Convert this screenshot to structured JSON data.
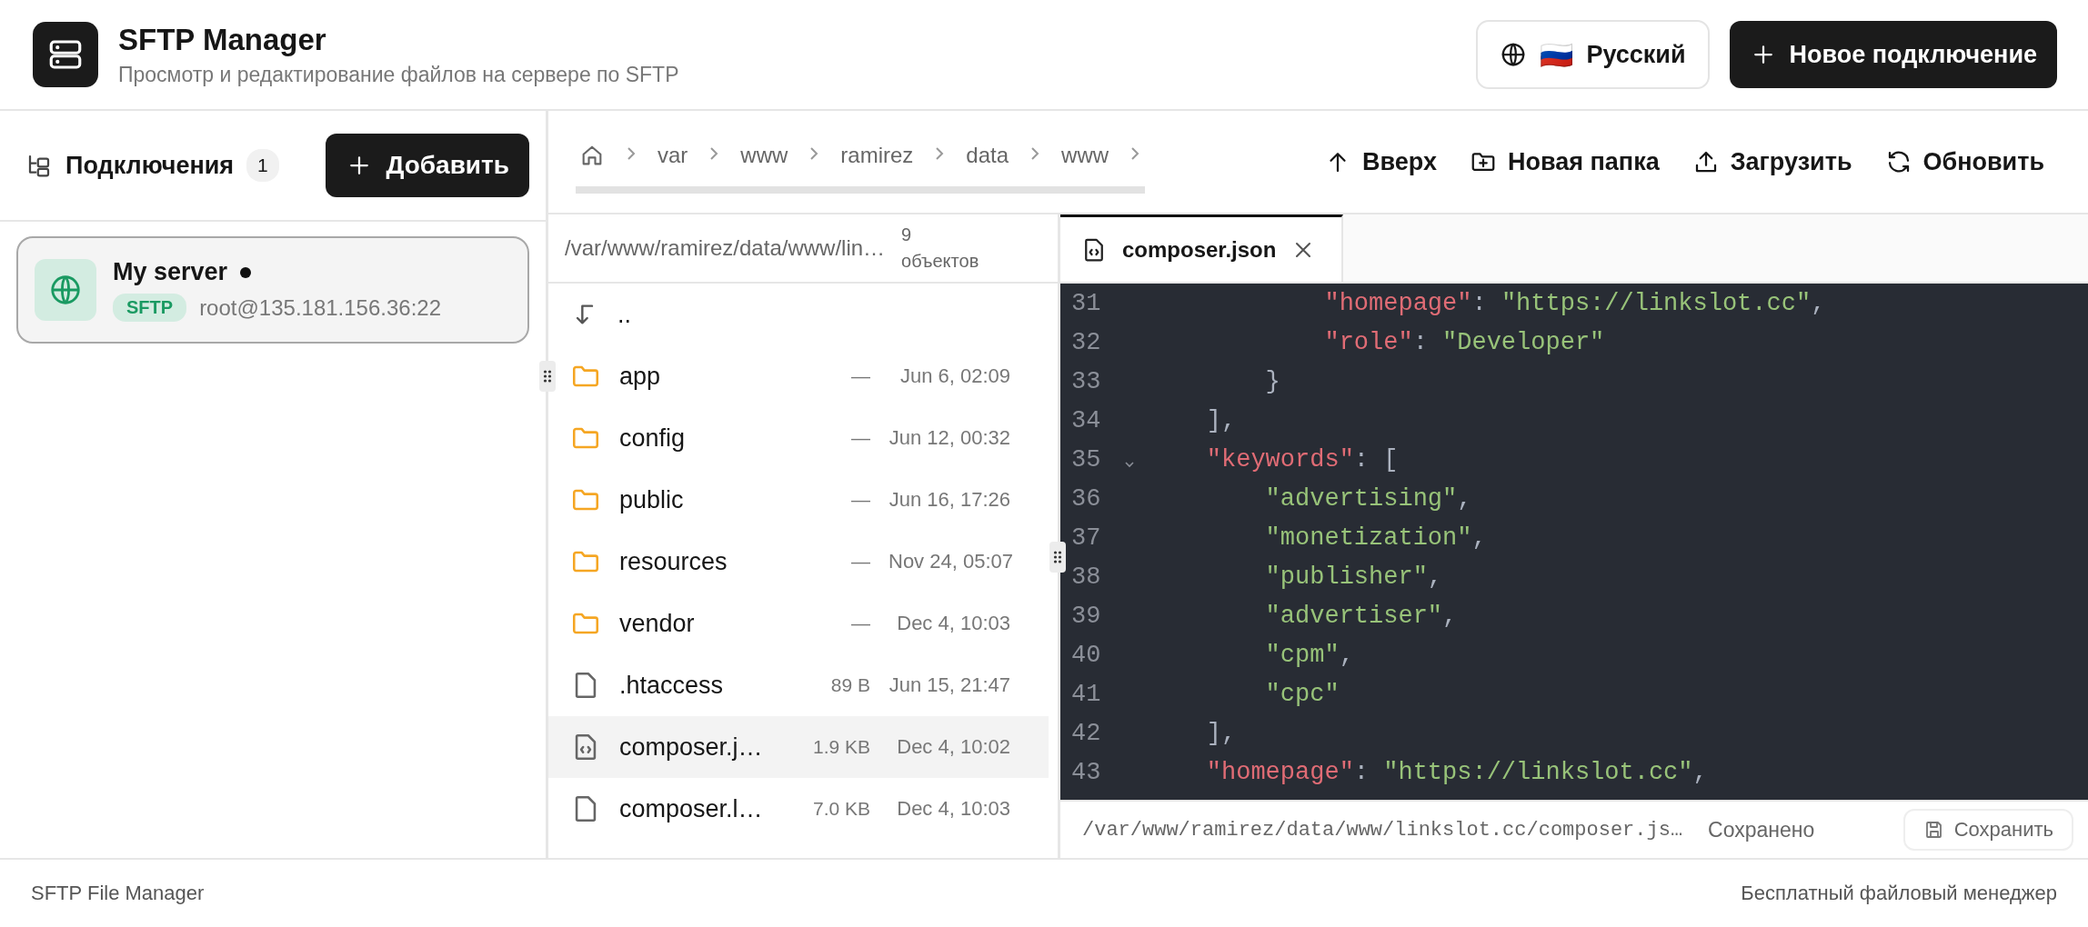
{
  "header": {
    "title": "SFTP Manager",
    "subtitle": "Просмотр и редактирование файлов на сервере по SFTP",
    "language": {
      "flag": "🇷🇺",
      "label": "Русский"
    },
    "new_connection": "Новое подключение"
  },
  "connections": {
    "title": "Подключения",
    "count": "1",
    "add": "Добавить",
    "items": [
      {
        "name": "My server",
        "connected": true,
        "protocol": "SFTP",
        "address": "root@135.181.156.36:22",
        "selected": true
      }
    ]
  },
  "breadcrumb": [
    "var",
    "www",
    "ramirez",
    "data",
    "www"
  ],
  "toolbar": [
    {
      "kind": "up",
      "label": "Вверх"
    },
    {
      "kind": "new-folder",
      "label": "Новая папка"
    },
    {
      "kind": "upload",
      "label": "Загрузить"
    },
    {
      "kind": "refresh",
      "label": "Обновить"
    }
  ],
  "file_list": {
    "path": "/var/www/ramirez/data/www/lin…",
    "count": "9 объектов",
    "parent": "..",
    "rows": [
      {
        "kind": "folder",
        "name": "app",
        "size": "—",
        "date": "Jun 6, 02:09",
        "selected": false
      },
      {
        "kind": "folder",
        "name": "config",
        "size": "—",
        "date": "Jun 12, 00:32",
        "selected": false
      },
      {
        "kind": "folder",
        "name": "public",
        "size": "—",
        "date": "Jun 16, 17:26",
        "selected": false
      },
      {
        "kind": "folder",
        "name": "resources",
        "size": "—",
        "date": "Nov 24, 05:07",
        "selected": false
      },
      {
        "kind": "folder",
        "name": "vendor",
        "size": "—",
        "date": "Dec 4, 10:03",
        "selected": false
      },
      {
        "kind": "file",
        "name": ".htaccess",
        "size": "89 B",
        "date": "Jun 15, 21:47",
        "selected": false
      },
      {
        "kind": "code",
        "name": "composer.j…",
        "size": "1.9 KB",
        "date": "Dec 4, 10:02",
        "selected": true
      },
      {
        "kind": "file",
        "name": "composer.l…",
        "size": "7.0 KB",
        "date": "Dec 4, 10:03",
        "selected": false
      }
    ]
  },
  "editor": {
    "tabs": [
      {
        "label": "composer.json",
        "selected": true
      }
    ],
    "lines": [
      {
        "num": "31",
        "fold": false,
        "tokens": [
          {
            "kind": "key",
            "text": "            \"homepage\""
          },
          {
            "kind": "punct",
            "text": ": "
          },
          {
            "kind": "string",
            "text": "\"https://linkslot.cc\""
          },
          {
            "kind": "punct",
            "text": ","
          }
        ]
      },
      {
        "num": "32",
        "fold": false,
        "tokens": [
          {
            "kind": "key",
            "text": "            \"role\""
          },
          {
            "kind": "punct",
            "text": ": "
          },
          {
            "kind": "string",
            "text": "\"Developer\""
          }
        ]
      },
      {
        "num": "33",
        "fold": false,
        "tokens": [
          {
            "kind": "punct",
            "text": "        }"
          }
        ]
      },
      {
        "num": "34",
        "fold": false,
        "tokens": [
          {
            "kind": "punct",
            "text": "    ],"
          }
        ]
      },
      {
        "num": "35",
        "fold": true,
        "tokens": [
          {
            "kind": "key",
            "text": "    \"keywords\""
          },
          {
            "kind": "punct",
            "text": ": ["
          }
        ]
      },
      {
        "num": "36",
        "fold": false,
        "tokens": [
          {
            "kind": "string",
            "text": "        \"advertising\""
          },
          {
            "kind": "punct",
            "text": ","
          }
        ]
      },
      {
        "num": "37",
        "fold": false,
        "tokens": [
          {
            "kind": "string",
            "text": "        \"monetization\""
          },
          {
            "kind": "punct",
            "text": ","
          }
        ]
      },
      {
        "num": "38",
        "fold": false,
        "tokens": [
          {
            "kind": "string",
            "text": "        \"publisher\""
          },
          {
            "kind": "punct",
            "text": ","
          }
        ]
      },
      {
        "num": "39",
        "fold": false,
        "tokens": [
          {
            "kind": "string",
            "text": "        \"advertiser\""
          },
          {
            "kind": "punct",
            "text": ","
          }
        ]
      },
      {
        "num": "40",
        "fold": false,
        "tokens": [
          {
            "kind": "string",
            "text": "        \"cpm\""
          },
          {
            "kind": "punct",
            "text": ","
          }
        ]
      },
      {
        "num": "41",
        "fold": false,
        "tokens": [
          {
            "kind": "string",
            "text": "        \"cpc\""
          }
        ]
      },
      {
        "num": "42",
        "fold": false,
        "tokens": [
          {
            "kind": "punct",
            "text": "    ],"
          }
        ]
      },
      {
        "num": "43",
        "fold": false,
        "tokens": [
          {
            "kind": "key",
            "text": "    \"homepage\""
          },
          {
            "kind": "punct",
            "text": ": "
          },
          {
            "kind": "string",
            "text": "\"https://linkslot.cc\""
          },
          {
            "kind": "punct",
            "text": ","
          }
        ]
      }
    ],
    "status": {
      "path": "/var/www/ramirez/data/www/linkslot.cc/composer.js…",
      "state": "Сохранено",
      "save": "Сохранить"
    }
  },
  "footer": {
    "left": "SFTP File Manager",
    "right": "Бесплатный файловый менеджер"
  }
}
